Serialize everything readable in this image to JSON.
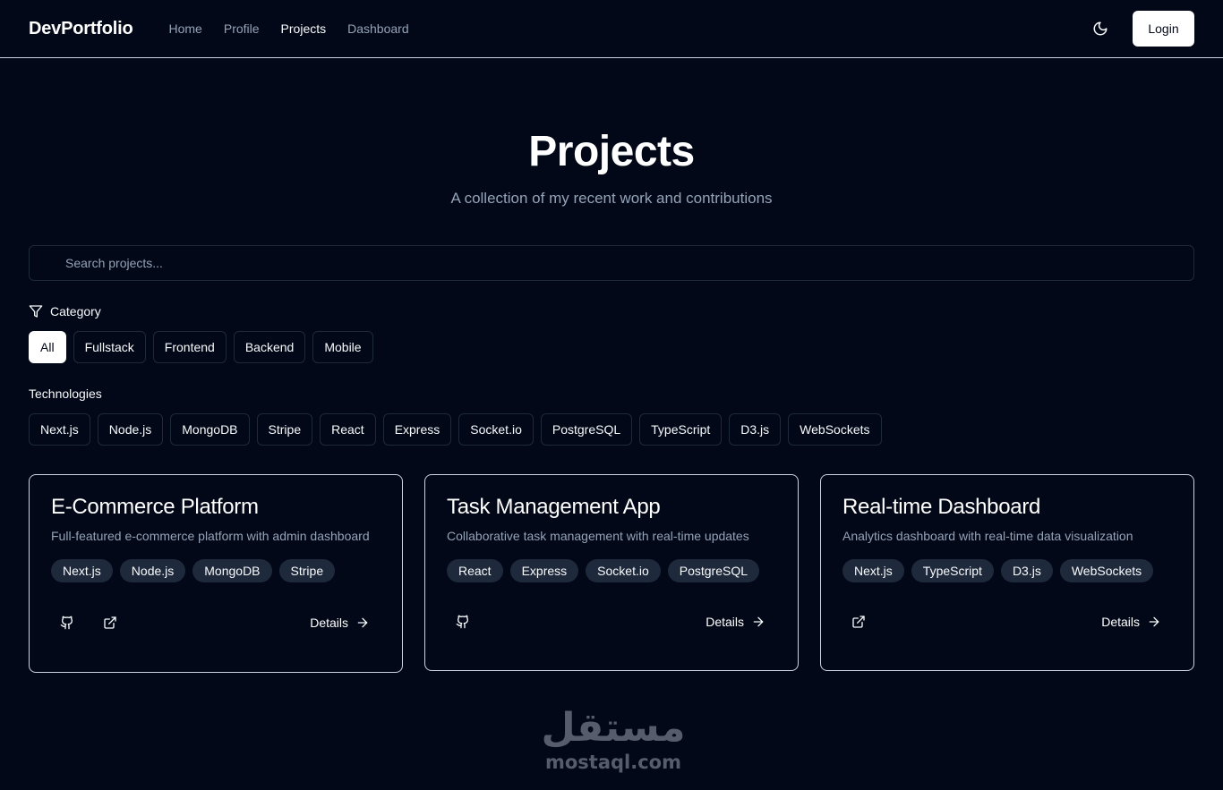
{
  "nav": {
    "brand": "DevPortfolio",
    "links": [
      "Home",
      "Profile",
      "Projects",
      "Dashboard"
    ],
    "active": "Projects",
    "login": "Login",
    "theme_icon": "moon-icon"
  },
  "hero": {
    "title": "Projects",
    "subtitle": "A collection of my recent work and contributions"
  },
  "search": {
    "placeholder": "Search projects...",
    "value": ""
  },
  "category": {
    "label": "Category",
    "options": [
      "All",
      "Fullstack",
      "Frontend",
      "Backend",
      "Mobile"
    ],
    "selected": "All"
  },
  "technologies": {
    "label": "Technologies",
    "options": [
      "Next.js",
      "Node.js",
      "MongoDB",
      "Stripe",
      "React",
      "Express",
      "Socket.io",
      "PostgreSQL",
      "TypeScript",
      "D3.js",
      "WebSockets"
    ]
  },
  "projects": [
    {
      "title": "E-Commerce Platform",
      "description": "Full-featured e-commerce platform with admin dashboard",
      "tags": [
        "Next.js",
        "Node.js",
        "MongoDB",
        "Stripe"
      ],
      "links": [
        "github-icon",
        "external-link-icon"
      ],
      "details": "Details"
    },
    {
      "title": "Task Management App",
      "description": "Collaborative task management with real-time updates",
      "tags": [
        "React",
        "Express",
        "Socket.io",
        "PostgreSQL"
      ],
      "links": [
        "github-icon"
      ],
      "details": "Details"
    },
    {
      "title": "Real-time Dashboard",
      "description": "Analytics dashboard with real-time data visualization",
      "tags": [
        "Next.js",
        "TypeScript",
        "D3.js",
        "WebSockets"
      ],
      "links": [
        "external-link-icon"
      ],
      "details": "Details"
    }
  ],
  "watermark": {
    "arabic": "مستقل",
    "latin": "mostaql.com"
  }
}
